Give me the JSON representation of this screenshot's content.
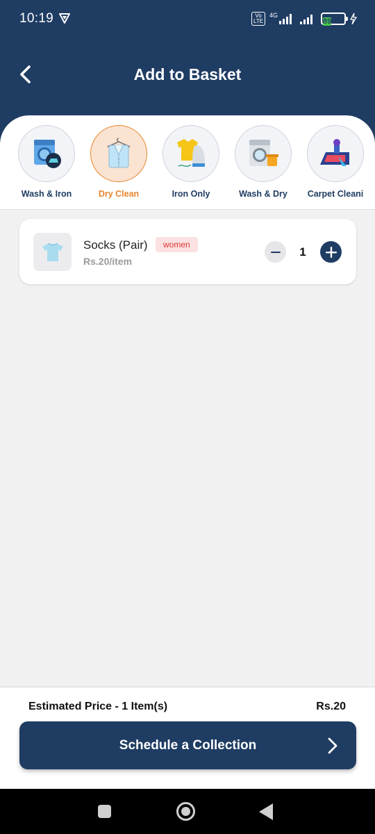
{
  "status_bar": {
    "time": "10:19",
    "network": "4G",
    "volte": "Vo LTE",
    "battery": "89"
  },
  "header": {
    "title": "Add to Basket"
  },
  "categories": [
    {
      "label": "Wash & Iron",
      "icon": "washing-machine-iron-icon"
    },
    {
      "label": "Dry Clean",
      "icon": "dry-clean-coat-icon",
      "active": true
    },
    {
      "label": "Iron Only",
      "icon": "iron-shirt-icon"
    },
    {
      "label": "Wash & Dry",
      "icon": "wash-dry-machine-icon"
    },
    {
      "label": "Carpet Cleani",
      "icon": "carpet-cleaning-icon"
    }
  ],
  "items": [
    {
      "name": "Socks (Pair)",
      "tag": "women",
      "price": "Rs.20/item",
      "quantity": "1",
      "icon": "tshirt-icon"
    }
  ],
  "footer": {
    "estimate_label": "Estimated Price - 1 Item(s)",
    "total": "Rs.20",
    "cta_label": "Schedule a Collection"
  },
  "colors": {
    "primary": "#1f3c63",
    "accent": "#e6862e",
    "tag_bg": "#fbe1e1",
    "tag_text": "#dd3333",
    "background": "#f1f1f2"
  }
}
